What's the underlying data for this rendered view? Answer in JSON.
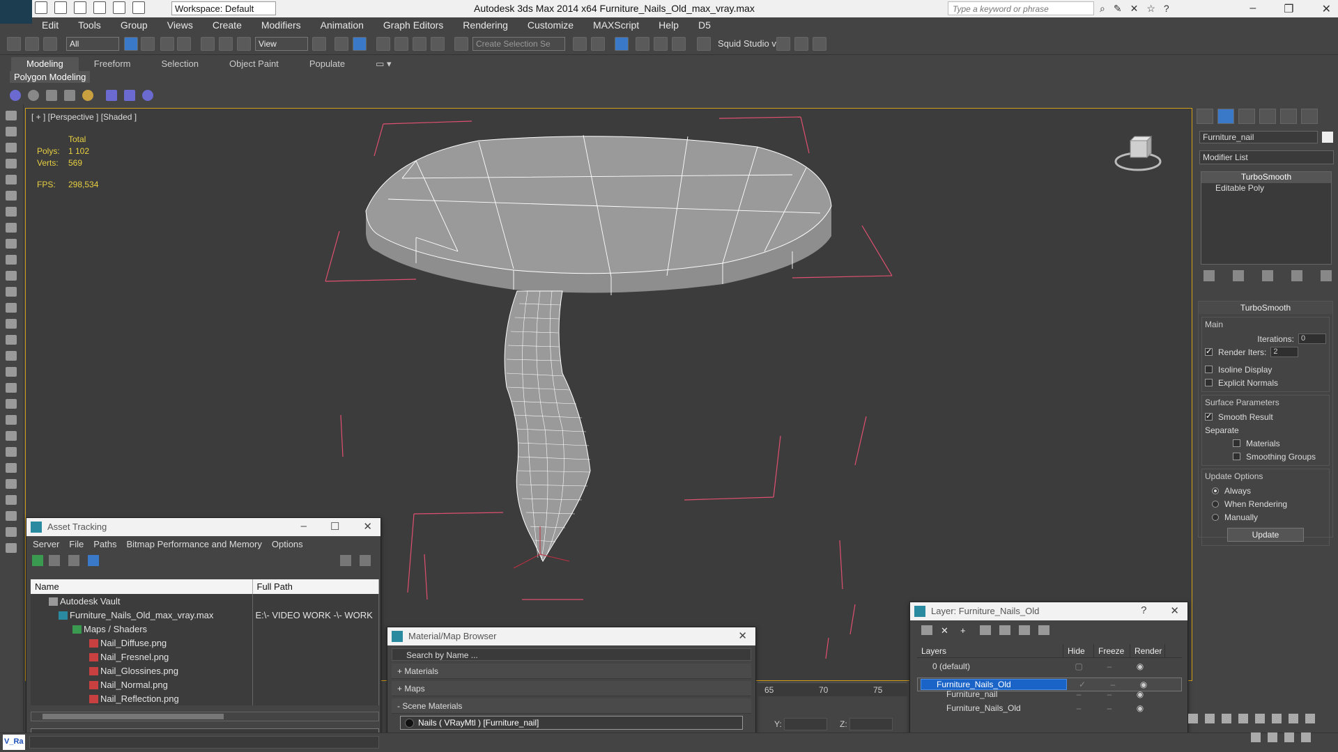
{
  "titlebar": {
    "workspace": "Workspace: Default",
    "title": "Autodesk 3ds Max  2014 x64     Furniture_Nails_Old_max_vray.max",
    "search_placeholder": "Type a keyword or phrase"
  },
  "menu": [
    "Edit",
    "Tools",
    "Group",
    "Views",
    "Create",
    "Modifiers",
    "Animation",
    "Graph Editors",
    "Rendering",
    "Customize",
    "MAXScript",
    "Help",
    "D5"
  ],
  "toolbar": {
    "filter": "All",
    "refcoord": "View",
    "selection_set": "Create Selection Se",
    "squid": "Squid Studio v"
  },
  "ribbon": {
    "tabs": [
      "Modeling",
      "Freeform",
      "Selection",
      "Object Paint",
      "Populate"
    ],
    "active_tab": "Modeling",
    "panel": "Polygon Modeling"
  },
  "viewport": {
    "label": "[ + ] [Perspective ] [Shaded ]",
    "stats_total": "Total",
    "polys_label": "Polys:",
    "polys_value": "1 102",
    "verts_label": "Verts:",
    "verts_value": "569",
    "fps_label": "FPS:",
    "fps_value": "298,534"
  },
  "command_panel": {
    "object_name": "Furniture_nail",
    "modifier_list": "Modifier List",
    "stack": [
      "TurboSmooth",
      "Editable Poly"
    ],
    "rollout_title": "TurboSmooth",
    "main_label": "Main",
    "iterations_label": "Iterations:",
    "iterations_value": "0",
    "render_iters_label": "Render Iters:",
    "render_iters_value": "2",
    "isoline": "Isoline Display",
    "explicit_normals": "Explicit Normals",
    "surface_params": "Surface Parameters",
    "smooth_result": "Smooth Result",
    "separate": "Separate",
    "materials": "Materials",
    "smoothing_groups": "Smoothing Groups",
    "update_options": "Update Options",
    "always": "Always",
    "when_rendering": "When Rendering",
    "manually": "Manually",
    "update_btn": "Update"
  },
  "asset_tracking": {
    "title": "Asset Tracking",
    "menu": [
      "Server",
      "File",
      "Paths",
      "Bitmap Performance and Memory",
      "Options"
    ],
    "col_name": "Name",
    "col_path": "Full Path",
    "rows": [
      {
        "name": "Autodesk Vault",
        "path": ""
      },
      {
        "name": "Furniture_Nails_Old_max_vray.max",
        "path": "E:\\- VIDEO WORK -\\- WORK"
      },
      {
        "name": "Maps / Shaders",
        "path": ""
      },
      {
        "name": "Nail_Diffuse.png",
        "path": ""
      },
      {
        "name": "Nail_Fresnel.png",
        "path": ""
      },
      {
        "name": "Nail_Glossines.png",
        "path": ""
      },
      {
        "name": "Nail_Normal.png",
        "path": ""
      },
      {
        "name": "Nail_Reflection.png",
        "path": ""
      }
    ]
  },
  "material_browser": {
    "title": "Material/Map Browser",
    "search": "Search by Name ...",
    "sections": [
      "+ Materials",
      "+ Maps",
      "- Scene Materials"
    ],
    "item": "Nails  ( VRayMtl ) [Furniture_nail]"
  },
  "layer_window": {
    "title": "Layer: Furniture_Nails_Old",
    "help": "?",
    "col_layers": "Layers",
    "col_hide": "Hide",
    "col_freeze": "Freeze",
    "col_render": "Render",
    "rows": [
      "0 (default)",
      "Furniture_Nails_Old",
      "Furniture_nail",
      "Furniture_Nails_Old"
    ]
  },
  "timeline": {
    "ticks": [
      "65",
      "70",
      "75"
    ]
  },
  "coords": {
    "y": "Y:",
    "z": "Z:"
  },
  "status": {
    "maxscript": "V_Ra"
  }
}
